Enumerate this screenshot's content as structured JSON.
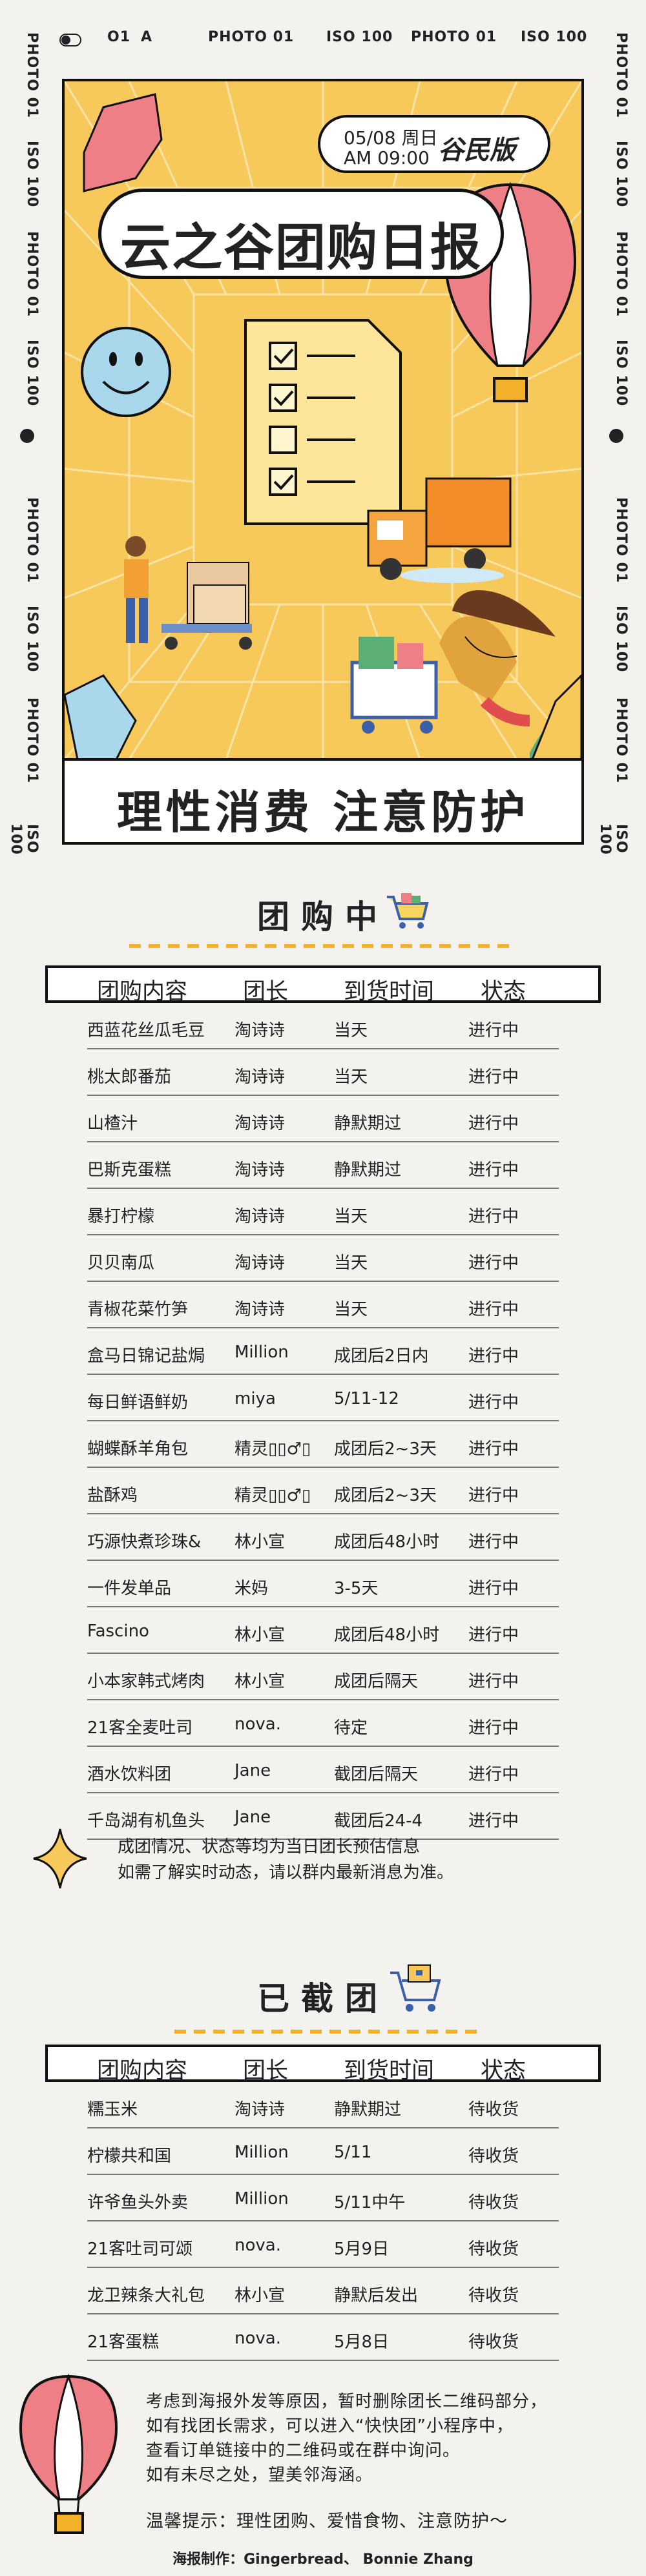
{
  "top_strip": {
    "code": "O1",
    "letter": "A",
    "labels": [
      "PHOTO 01",
      "ISO 100",
      "PHOTO 01",
      "ISO 100"
    ]
  },
  "side_strip": {
    "labels": [
      "PHOTO 01",
      "ISO 100",
      "PHOTO 01",
      "ISO 100",
      "PHOTO 01",
      "ISO 100",
      "PHOTO 01",
      "ISO 100"
    ]
  },
  "hero": {
    "date": "05/08 周日",
    "time": "AM 09:00",
    "edition": "谷民版",
    "title": "云之谷团购日报",
    "slogan": "理性消费 注意防护"
  },
  "ongoing": {
    "title": "团购中",
    "headers": [
      "团购内容",
      "团长",
      "到货时间",
      "状态"
    ],
    "rows": [
      [
        "西蓝花丝瓜毛豆",
        "淘诗诗",
        "当天",
        "进行中"
      ],
      [
        "桃太郎番茄",
        "淘诗诗",
        "当天",
        "进行中"
      ],
      [
        "山楂汁",
        "淘诗诗",
        "静默期过",
        "进行中"
      ],
      [
        "巴斯克蛋糕",
        "淘诗诗",
        "静默期过",
        "进行中"
      ],
      [
        "暴打柠檬",
        "淘诗诗",
        "当天",
        "进行中"
      ],
      [
        "贝贝南瓜",
        "淘诗诗",
        "当天",
        "进行中"
      ],
      [
        "青椒花菜竹笋",
        "淘诗诗",
        "当天",
        "进行中"
      ],
      [
        "盒马日锦记盐焗",
        "Million",
        "成团后2日内",
        "进行中"
      ],
      [
        "每日鲜语鲜奶",
        "miya",
        "5/11-12",
        "进行中"
      ],
      [
        "蝴蝶酥羊角包",
        "精灵▯▯♂▯",
        "成团后2~3天",
        "进行中"
      ],
      [
        "盐酥鸡",
        "精灵▯▯♂▯",
        "成团后2~3天",
        "进行中"
      ],
      [
        "巧源快煮珍珠&",
        "林小宣",
        "成团后48小时",
        "进行中"
      ],
      [
        "一件发单品",
        "米妈",
        "3-5天",
        "进行中"
      ],
      [
        "Fascino",
        "林小宣",
        "成团后48小时",
        "进行中"
      ],
      [
        "小本家韩式烤肉",
        "林小宣",
        "成团后隔天",
        "进行中"
      ],
      [
        "21客全麦吐司",
        "nova.",
        "待定",
        "进行中"
      ],
      [
        "酒水饮料团",
        "Jane",
        "截团后隔天",
        "进行中"
      ],
      [
        "千岛湖有机鱼头",
        "Jane",
        "截团后24-4",
        "进行中"
      ]
    ],
    "note_lines": [
      "成团情况、状态等均为当日团长预估信息",
      "如需了解实时动态，请以群内最新消息为准。"
    ]
  },
  "closed": {
    "title": "已截团",
    "headers": [
      "团购内容",
      "团长",
      "到货时间",
      "状态"
    ],
    "rows": [
      [
        "糯玉米",
        "淘诗诗",
        "静默期过",
        "待收货"
      ],
      [
        "柠檬共和国",
        "Million",
        "5/11",
        "待收货"
      ],
      [
        "许爷鱼头外卖",
        "Million",
        "5/11中午",
        "待收货"
      ],
      [
        "21客吐司可颂",
        "nova.",
        "5月9日",
        "待收货"
      ],
      [
        "龙卫辣条大礼包",
        "林小宣",
        "静默后发出",
        "待收货"
      ],
      [
        "21客蛋糕",
        "nova.",
        "5月8日",
        "待收货"
      ]
    ]
  },
  "footer": {
    "notice_lines": [
      "考虑到海报外发等原因，暂时删除团长二维码部分，",
      "如有找团长需求，可以进入“快快团”小程序中，",
      "查看订单链接中的二维码或在群中询问。",
      "如有未尽之处，望美邻海涵。"
    ],
    "tip": "温馨提示：理性团购、爱惜食物、注意防护～",
    "credit": "海报制作：Gingerbread、 Bonnie Zhang"
  },
  "colors": {
    "background": "#f3f2ee",
    "hero_yellow": "#f7c85a",
    "accent_orange": "#f2b02b",
    "balloon_pink": "#ef7f86"
  }
}
